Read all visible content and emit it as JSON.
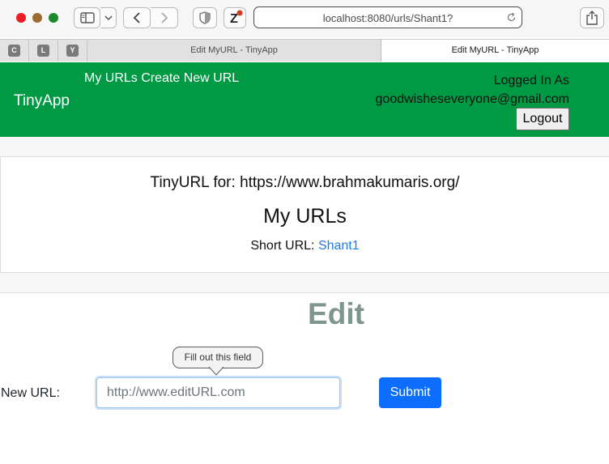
{
  "browser": {
    "address_url": "localhost:8080/urls/Shant1?",
    "tabs": {
      "pinned": [
        "C",
        "L",
        "Y"
      ],
      "inactive_title": "Edit MyURL - TinyApp",
      "active_title": "Edit MyURL - TinyApp"
    },
    "icons": {
      "sidebar": "sidebar-icon",
      "back": "chevron-left-icon",
      "forward": "chevron-right-icon",
      "shield": "shield-icon",
      "extension": "zotero-icon",
      "reload": "reload-icon",
      "share": "share-icon"
    }
  },
  "nav": {
    "brand": "TinyApp",
    "links": [
      "My URLs",
      "Create New URL"
    ],
    "logged_in_label": "Logged In As",
    "user_email": "goodwisheseveryone@gmail.com",
    "logout_label": "Logout",
    "bg_color": "#009a44"
  },
  "url_card": {
    "tinyurl_prefix": "TinyURL for:",
    "long_url": "https://www.brahmakumaris.org/",
    "heading": "My URLs",
    "short_url_label": "Short URL:",
    "short_url_value": "Shant1"
  },
  "edit_form": {
    "title": "Edit",
    "new_url_label": "New URL:",
    "input_placeholder": "http://www.editURL.com",
    "submit_label": "Submit",
    "validation_tooltip": "Fill out this field"
  }
}
